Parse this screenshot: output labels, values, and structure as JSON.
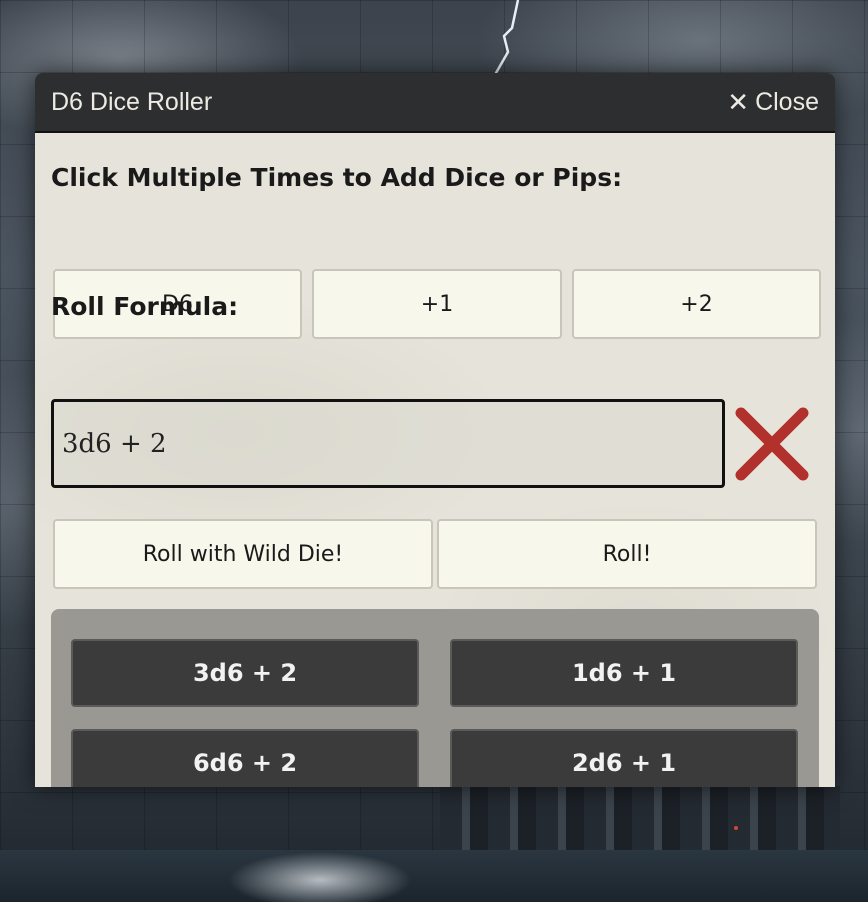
{
  "dialog": {
    "title": "D6 Dice Roller",
    "close_label": "Close"
  },
  "add_section": {
    "heading": "Click Multiple Times to Add Dice or Pips:",
    "buttons": [
      "D6",
      "+1",
      "+2"
    ]
  },
  "formula_section": {
    "heading": "Roll Formula:",
    "value": "3d6 + 2",
    "clear_icon": "red-x-icon"
  },
  "roll_buttons": {
    "wild": "Roll with Wild Die!",
    "roll": "Roll!"
  },
  "presets": [
    "3d6 + 2",
    "1d6 + 1",
    "6d6 + 2",
    "2d6 + 1"
  ],
  "colors": {
    "title_bar": "#2d2e30",
    "panel_bg": "#e6e4da",
    "preset_button": "#3b3b3b",
    "clear_x": "#b3312c"
  }
}
